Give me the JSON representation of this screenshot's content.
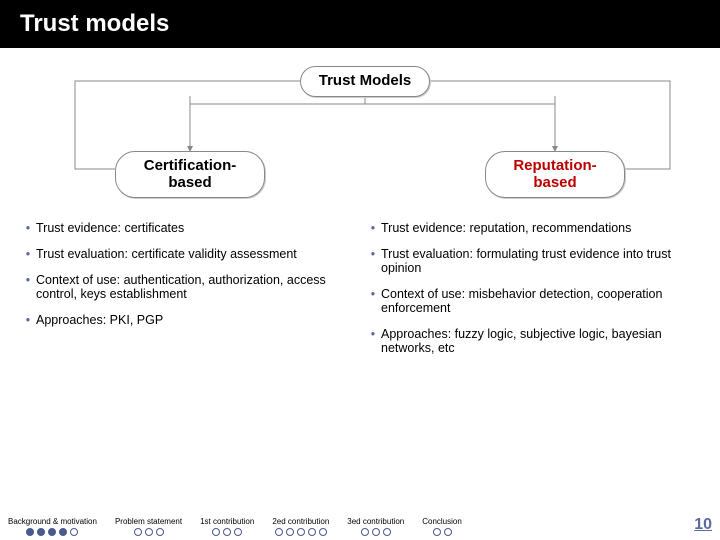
{
  "title": "Trust models",
  "root_node": "Trust Models",
  "left_branch": "Certification-based",
  "right_branch": "Reputation-based",
  "cert": {
    "evidence_label": "Trust evidence:",
    "evidence_value": "certificates",
    "eval_label": "Trust evaluation:",
    "eval_value": "certificate validity assessment",
    "context_label": "Context of use:",
    "context_value": "authentication, authorization, access control, keys establishment",
    "approach_label": "Approaches:",
    "approach_value": "PKI, PGP"
  },
  "rep": {
    "evidence_label": "Trust evidence:",
    "evidence_value": "reputation, recommendations",
    "eval_label": "Trust evaluation:",
    "eval_value": "formulating trust evidence into trust opinion",
    "context_label": "Context of use:",
    "context_value": "misbehavior detection, cooperation enforcement",
    "approach_label": "Approaches:",
    "approach_value": "fuzzy logic, subjective logic, bayesian networks, etc"
  },
  "stages": [
    {
      "label": "Background & motivation",
      "filled": 4,
      "open": 1
    },
    {
      "label": "Problem statement",
      "filled": 0,
      "open": 3
    },
    {
      "label": "1st contribution",
      "filled": 0,
      "open": 3
    },
    {
      "label": "2ed contribution",
      "filled": 0,
      "open": 5
    },
    {
      "label": "3ed contribution",
      "filled": 0,
      "open": 3
    },
    {
      "label": "Conclusion",
      "filled": 0,
      "open": 2
    }
  ],
  "page_number": "10"
}
